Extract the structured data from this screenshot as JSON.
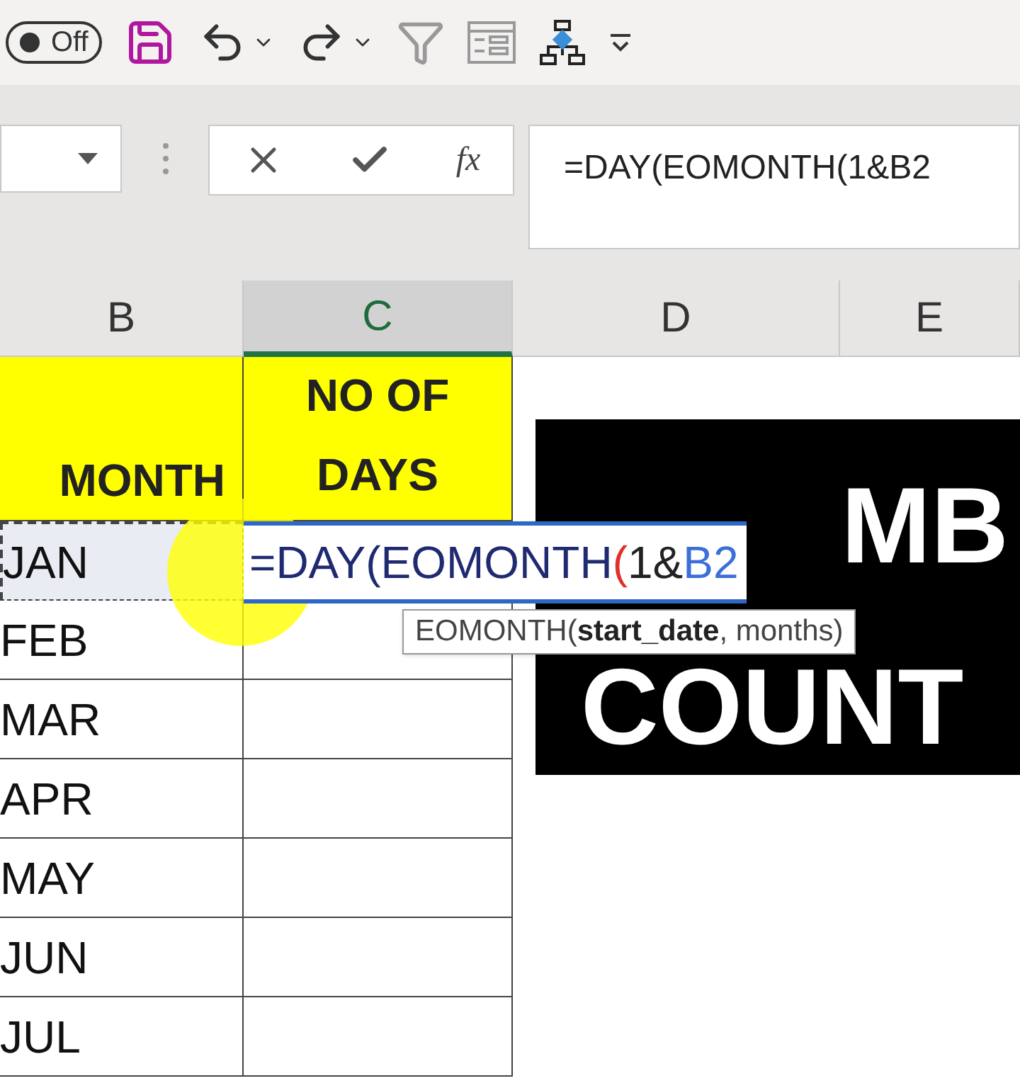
{
  "toolbar": {
    "autosave": {
      "label": "Off",
      "on": false
    }
  },
  "formula_bar": {
    "fx_label": "fx",
    "formula": "=DAY(EOMONTH(1&B2"
  },
  "columns": [
    {
      "label": "B",
      "selected": false
    },
    {
      "label": "C",
      "selected": true
    },
    {
      "label": "D",
      "selected": false
    },
    {
      "label": "E",
      "selected": false
    }
  ],
  "header_row": {
    "month": "MONTH",
    "days": "NO OF DAYS"
  },
  "months": [
    {
      "text": "JAN",
      "selected": true
    },
    {
      "text": "FEB",
      "selected": false
    },
    {
      "text": "MAR",
      "selected": false
    },
    {
      "text": "APR",
      "selected": false
    },
    {
      "text": "MAY",
      "selected": false
    },
    {
      "text": "JUN",
      "selected": false
    },
    {
      "text": "JUL",
      "selected": false
    }
  ],
  "edit_cell": {
    "segments": [
      {
        "text": "=DAY(EOMONTH",
        "color": "#1f2a70"
      },
      {
        "text": "(",
        "color": "#e0302a"
      },
      {
        "text": "1&",
        "color": "#222222"
      },
      {
        "text": "B2",
        "color": "#3c6fd8"
      }
    ]
  },
  "tooltip": {
    "name": "EOMONTH(",
    "bold_arg": "start_date",
    "rest": ", months)"
  },
  "text_box": {
    "lines": [
      "MB",
      "COUNT"
    ]
  }
}
